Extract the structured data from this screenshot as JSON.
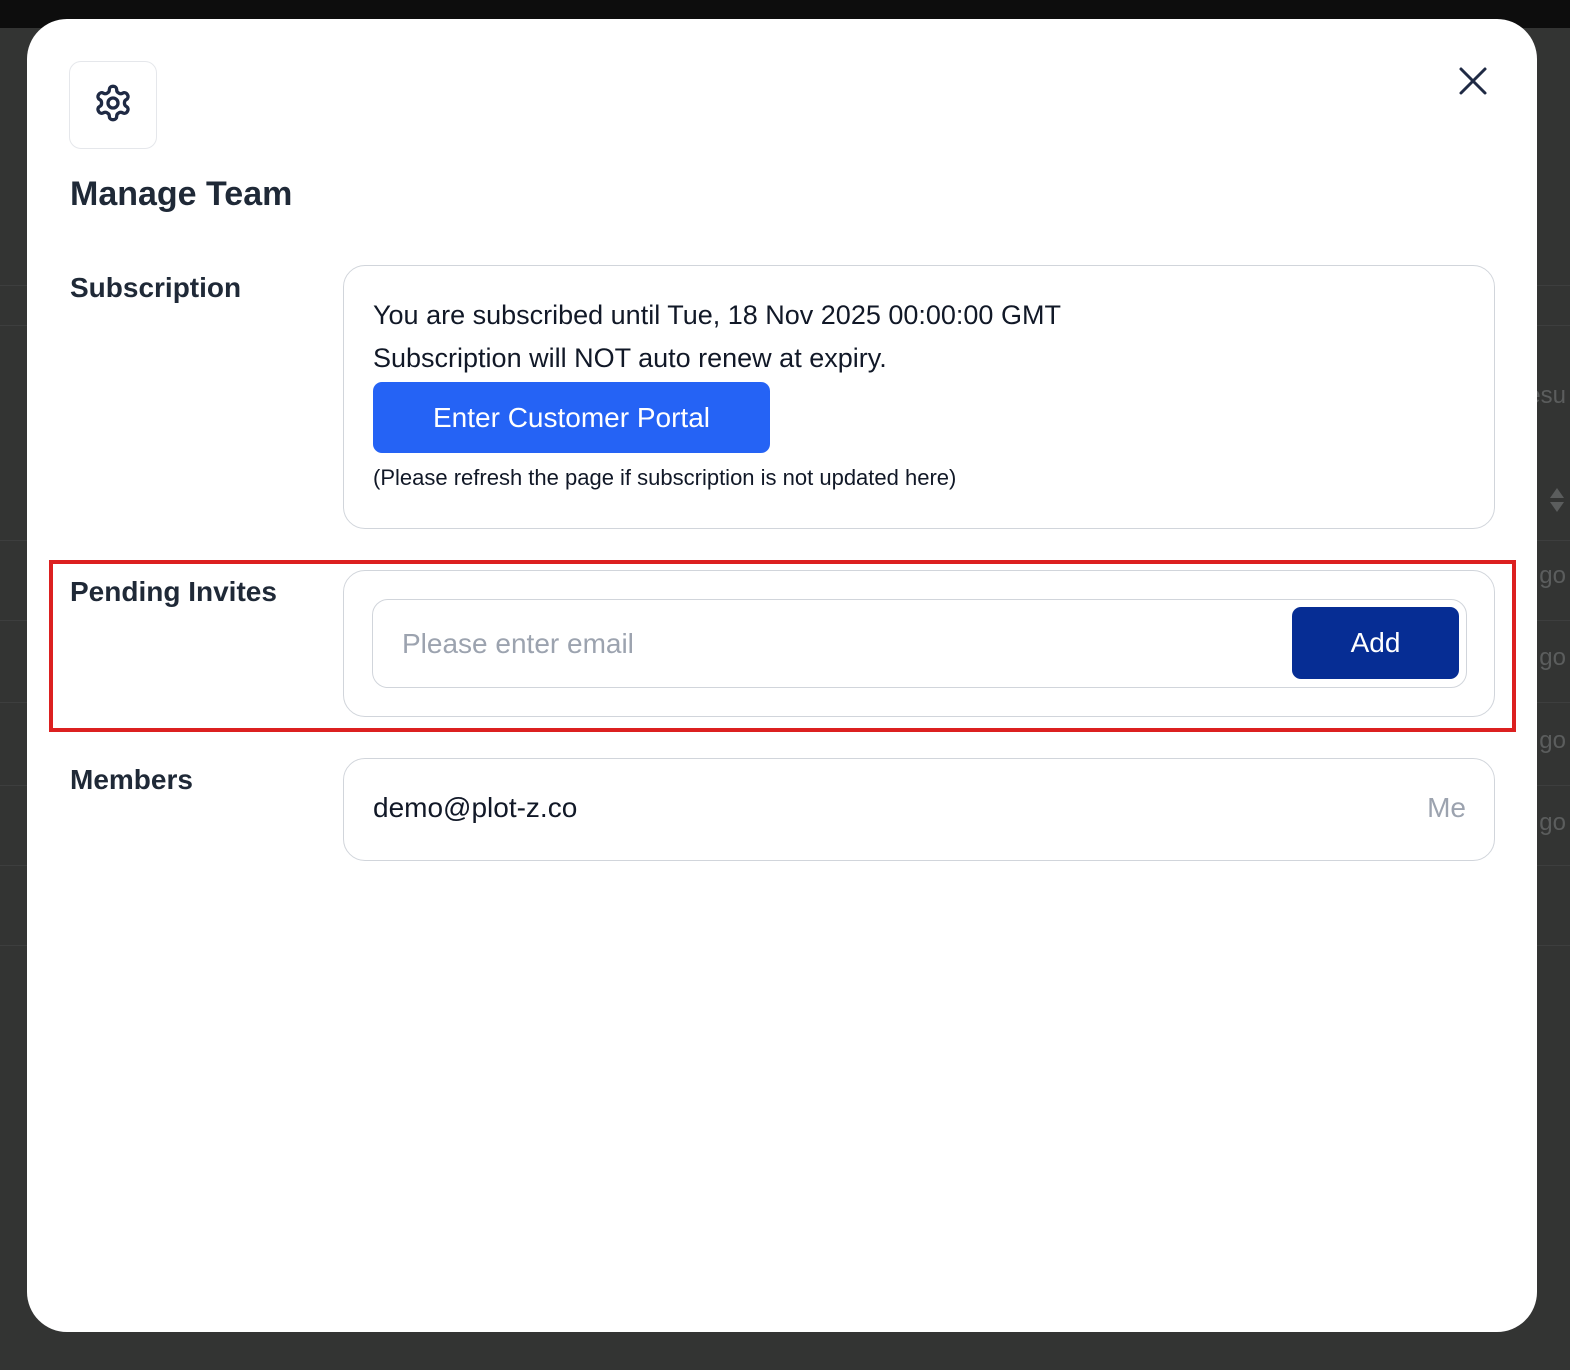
{
  "modal": {
    "title": "Manage Team",
    "header_icon": "gear-icon",
    "close_icon": "close-icon"
  },
  "subscription": {
    "label": "Subscription",
    "status_line": "You are subscribed until Tue, 18 Nov 2025 00:00:00 GMT",
    "renew_line": "Subscription will NOT auto renew at expiry.",
    "portal_button_label": "Enter Customer Portal",
    "refresh_note": "(Please refresh the page if subscription is not updated here)",
    "button_color": "#2563f5"
  },
  "pending_invites": {
    "label": "Pending Invites",
    "email_placeholder": "Please enter email",
    "email_value": "",
    "add_button_label": "Add",
    "button_color": "#062d94"
  },
  "members": {
    "label": "Members",
    "items": [
      {
        "email": "demo@plot-z.co",
        "tag": "Me"
      }
    ]
  },
  "background_fragments": [
    "esu",
    "go",
    "go",
    "go",
    "go"
  ],
  "highlight_color": "#dc2020"
}
